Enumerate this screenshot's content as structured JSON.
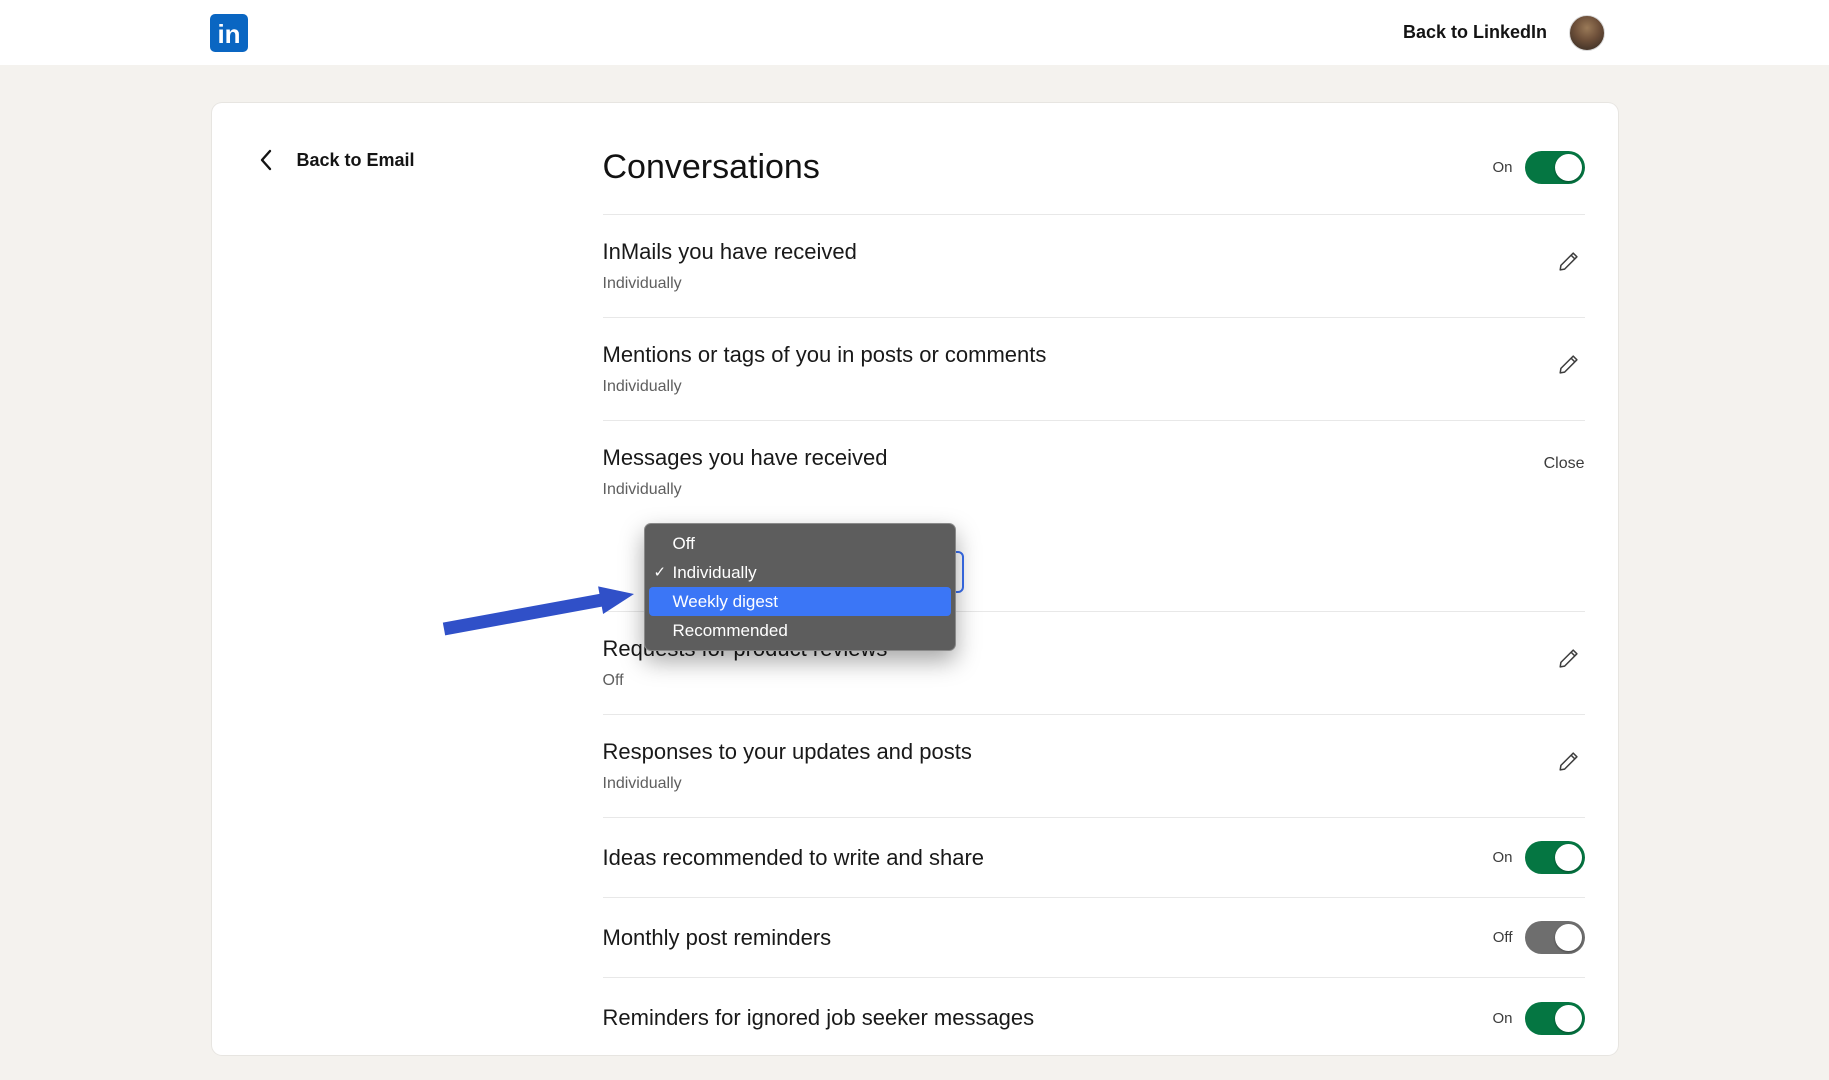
{
  "header": {
    "logo_text": "in",
    "back_link": "Back to LinkedIn"
  },
  "page": {
    "back_button": "Back to Email",
    "title": "Conversations",
    "master_toggle": {
      "label": "On",
      "state": "on"
    },
    "rows": [
      {
        "title": "InMails you have received",
        "subtitle": "Individually"
      },
      {
        "title": "Mentions or tags of you in posts or comments",
        "subtitle": "Individually"
      },
      {
        "title": "Messages you have received",
        "subtitle": "Individually",
        "action": "Close"
      },
      {
        "title": "Requests for product reviews",
        "subtitle": "Off"
      },
      {
        "title": "Responses to your updates and posts",
        "subtitle": "Individually"
      },
      {
        "title": "Ideas recommended to write and share",
        "toggle_label": "On",
        "toggle_state": "on"
      },
      {
        "title": "Monthly post reminders",
        "toggle_label": "Off",
        "toggle_state": "off"
      },
      {
        "title": "Reminders for ignored job seeker messages",
        "toggle_label": "On",
        "toggle_state": "on"
      }
    ],
    "dropdown": {
      "checkmark": "✓",
      "options": [
        {
          "label": "Off"
        },
        {
          "label": "Individually"
        },
        {
          "label": "Weekly digest"
        },
        {
          "label": "Recommended"
        }
      ],
      "selected": "Individually",
      "highlighted": "Weekly digest"
    },
    "colors": {
      "brand_blue": "#0a66c2",
      "toggle_on_green": "#057642",
      "toggle_off_gray": "#6e6e6e",
      "highlight_blue": "#3b76f6",
      "arrow_blue": "#3050c8"
    }
  }
}
